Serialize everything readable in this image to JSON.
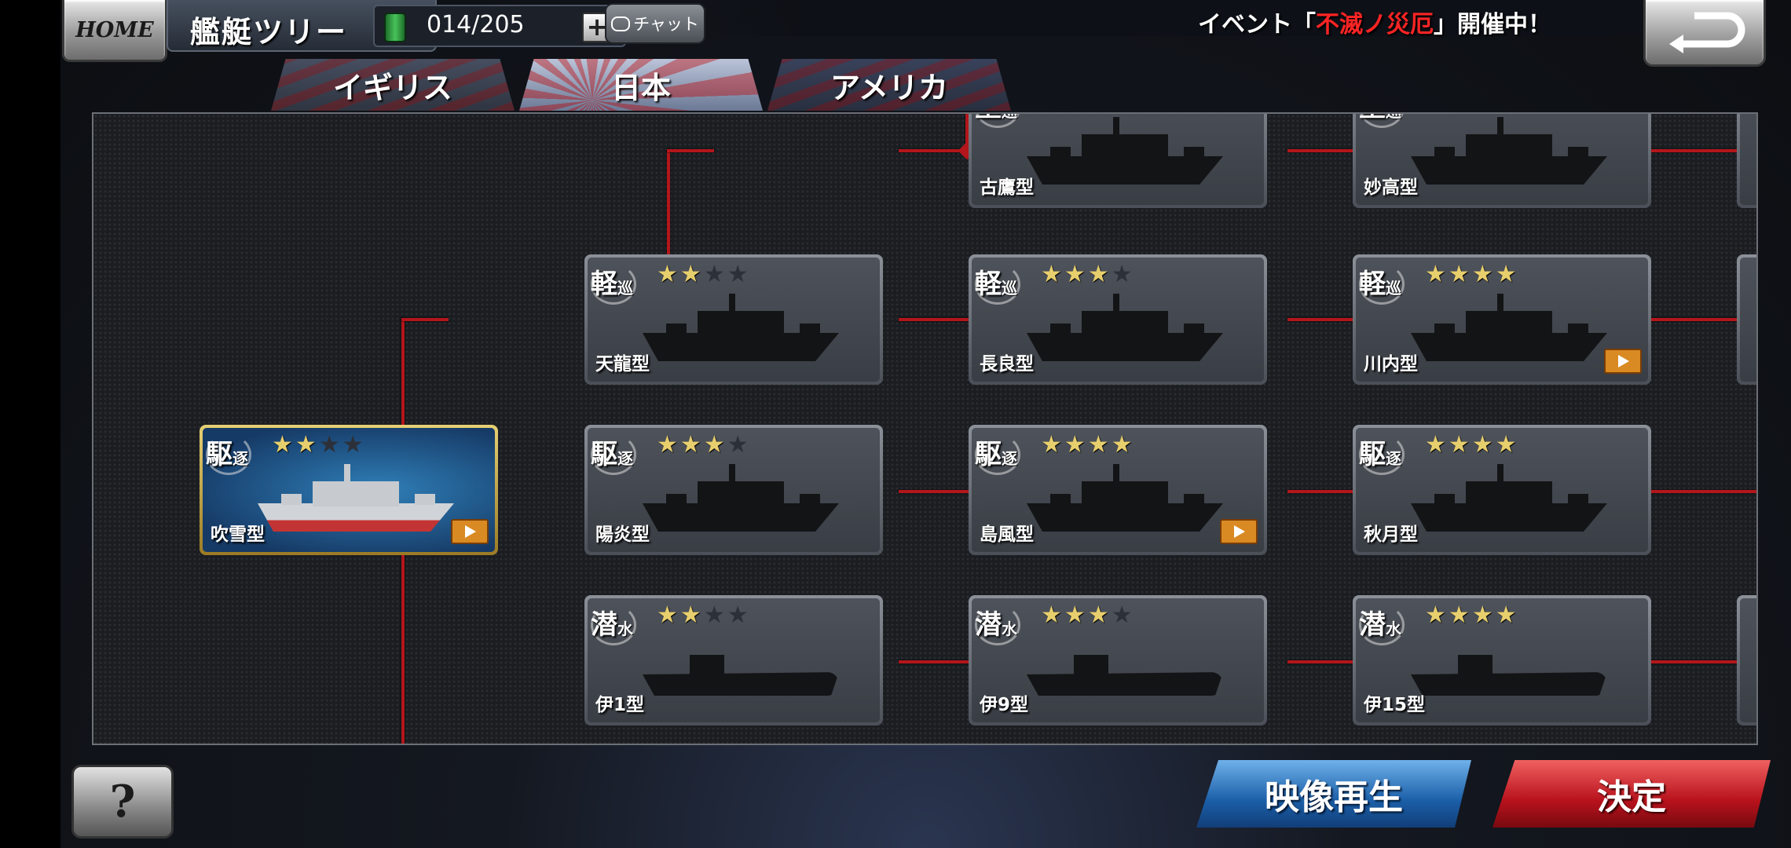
{
  "header": {
    "home_label": "HOME",
    "title": "艦艇ツリー",
    "counter": "014/205",
    "plus_label": "+",
    "chat_label": "チャット",
    "event_prefix": "イベント「",
    "event_name": "不滅ノ災厄",
    "event_suffix": "」開催中！"
  },
  "tabs": [
    {
      "label": "イギリス"
    },
    {
      "label": "日本",
      "active": true
    },
    {
      "label": "アメリカ"
    }
  ],
  "ships": {
    "furutaka": {
      "type_main": "重",
      "type_sub": "巡",
      "stars": 0,
      "name": "古鷹型"
    },
    "myoko": {
      "type_main": "重",
      "type_sub": "巡",
      "stars": 0,
      "name": "妙高型"
    },
    "tenryu": {
      "type_main": "軽",
      "type_sub": "巡",
      "stars": 2,
      "name": "天龍型"
    },
    "nagara": {
      "type_main": "軽",
      "type_sub": "巡",
      "stars": 3,
      "name": "長良型"
    },
    "sendai": {
      "type_main": "軽",
      "type_sub": "巡",
      "stars": 4,
      "name": "川内型",
      "video": true
    },
    "fubuki": {
      "type_main": "駆",
      "type_sub": "逐",
      "stars": 2,
      "name": "吹雪型",
      "video": true,
      "selected": true
    },
    "kagero": {
      "type_main": "駆",
      "type_sub": "逐",
      "stars": 3,
      "name": "陽炎型"
    },
    "shimakaze": {
      "type_main": "駆",
      "type_sub": "逐",
      "stars": 4,
      "name": "島風型",
      "video": true
    },
    "akizuki": {
      "type_main": "駆",
      "type_sub": "逐",
      "stars": 4,
      "name": "秋月型"
    },
    "i1": {
      "type_main": "潜",
      "type_sub": "水",
      "stars": 2,
      "name": "伊1型"
    },
    "i9": {
      "type_main": "潜",
      "type_sub": "水",
      "stars": 3,
      "name": "伊9型"
    },
    "i15": {
      "type_main": "潜",
      "type_sub": "水",
      "stars": 4,
      "name": "伊15型"
    }
  },
  "footer": {
    "help_label": "?",
    "video_label": "映像再生",
    "decide_label": "決定"
  },
  "colors": {
    "tree_line": "#b3161b",
    "star_on": "#e8cf6d",
    "star_off": "#2c3038"
  }
}
